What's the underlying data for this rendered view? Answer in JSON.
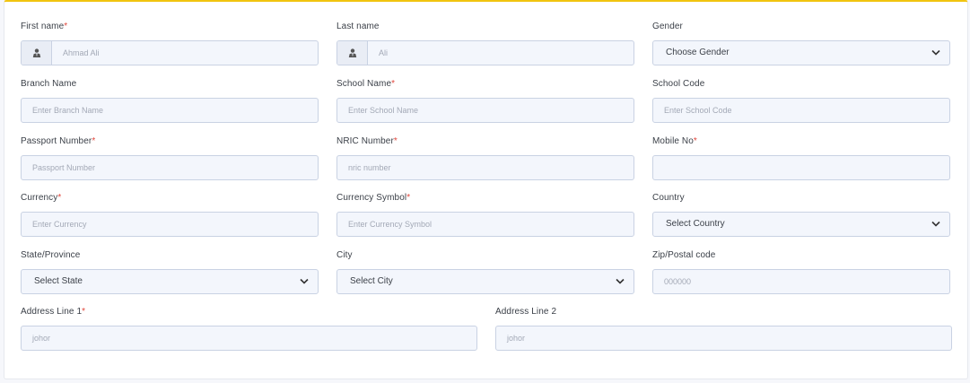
{
  "form": {
    "first_name": {
      "label": "First name",
      "required": "*",
      "value": "Ahmad Ali",
      "icon": "user-tie-icon"
    },
    "last_name": {
      "label": "Last name",
      "value": "Ali",
      "icon": "user-tie-icon"
    },
    "gender": {
      "label": "Gender",
      "selected": "Choose Gender"
    },
    "branch_name": {
      "label": "Branch Name",
      "placeholder": "Enter Branch Name"
    },
    "school_name": {
      "label": "School Name",
      "required": "*",
      "placeholder": "Enter School Name"
    },
    "school_code": {
      "label": "School Code",
      "placeholder": "Enter School Code"
    },
    "passport_number": {
      "label": "Passport Number",
      "required": "*",
      "placeholder": "Passport Number"
    },
    "nric_number": {
      "label": "NRIC Number",
      "required": "*",
      "placeholder": "nric number"
    },
    "mobile_no": {
      "label": "Mobile No",
      "required": "*",
      "value": ""
    },
    "currency": {
      "label": "Currency",
      "required": "*",
      "placeholder": "Enter Currency"
    },
    "currency_symbol": {
      "label": "Currency Symbol",
      "required": "*",
      "placeholder": "Enter Currency Symbol"
    },
    "country": {
      "label": "Country",
      "selected": "Select Country"
    },
    "state": {
      "label": "State/Province",
      "selected": "Select State"
    },
    "city": {
      "label": "City",
      "selected": "Select City"
    },
    "zip": {
      "label": "Zip/Postal code",
      "placeholder": "000000"
    },
    "address1": {
      "label": "Address Line 1",
      "required": "*",
      "placeholder": "johor"
    },
    "address2": {
      "label": "Address Line 2",
      "placeholder": "johor"
    }
  },
  "colors": {
    "accent": "#f1c40f",
    "required": "#e0473c",
    "field_bg": "#f3f6fc",
    "field_border": "#c9d2e3"
  }
}
